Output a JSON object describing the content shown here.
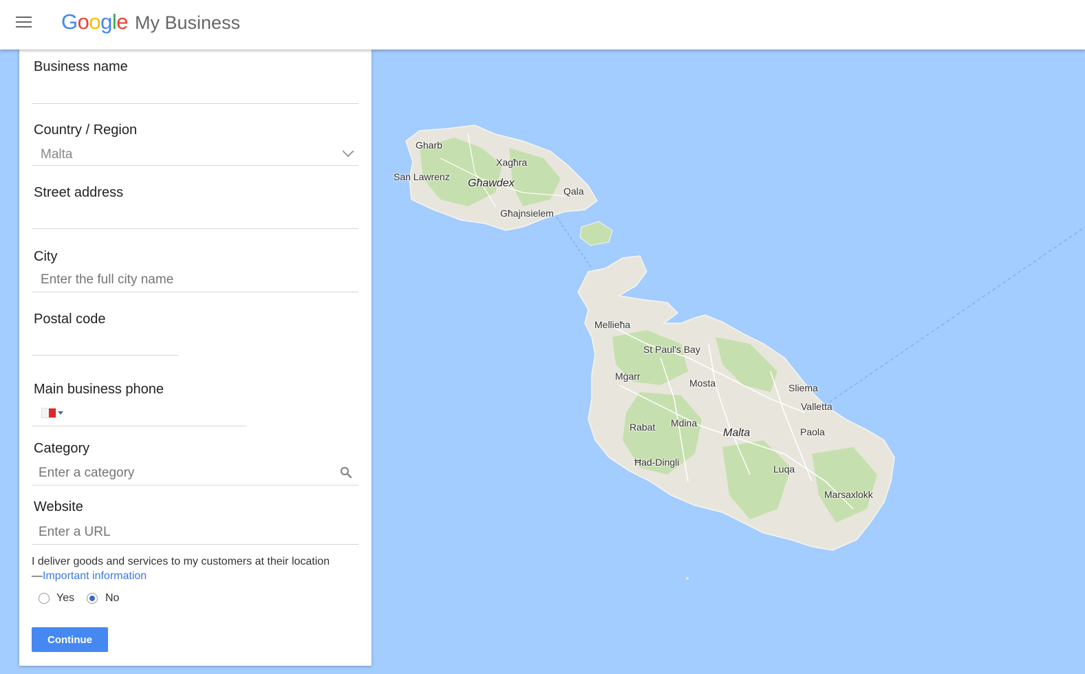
{
  "header": {
    "menu_icon": "hamburger-menu-icon",
    "logo_letters": [
      {
        "ch": "G",
        "color": "#4285f4"
      },
      {
        "ch": "o",
        "color": "#ea4335"
      },
      {
        "ch": "o",
        "color": "#fbbc05"
      },
      {
        "ch": "g",
        "color": "#4285f4"
      },
      {
        "ch": "l",
        "color": "#34a853"
      },
      {
        "ch": "e",
        "color": "#ea4335"
      }
    ],
    "product_name": "My Business"
  },
  "form": {
    "business_name": {
      "label": "Business name",
      "value": ""
    },
    "country": {
      "label": "Country / Region",
      "value": "Malta"
    },
    "street": {
      "label": "Street address",
      "value": ""
    },
    "city": {
      "label": "City",
      "placeholder": "Enter the full city name"
    },
    "postal": {
      "label": "Postal code",
      "value": ""
    },
    "phone": {
      "label": "Main business phone",
      "value": "",
      "flag_icon": "malta-flag-icon"
    },
    "category": {
      "label": "Category",
      "placeholder": "Enter a category",
      "icon": "search-icon"
    },
    "website": {
      "label": "Website",
      "placeholder": "Enter a URL"
    },
    "delivery": {
      "question": "I deliver goods and services to my customers at their location",
      "dash": "—",
      "link": "Important information",
      "options": [
        {
          "label": "Yes",
          "checked": false
        },
        {
          "label": "No",
          "checked": true
        }
      ]
    },
    "continue_label": "Continue",
    "accent_color": "#4688f1"
  },
  "map": {
    "water_color": "#a3ccff",
    "land_color": "#e8e6dc",
    "green_color": "#c6dfae",
    "labels": {
      "gharb": "Gharb",
      "xaghra": "Xagħra",
      "san_lawrenz": "San Lawrenz",
      "ghawdex": "Għawdex",
      "qala": "Qala",
      "ghajnsielem": "Għajnsielem",
      "mellieha": "Mellieħa",
      "st_pauls_bay": "St Paul's Bay",
      "mgarr": "Mġarr",
      "mosta": "Mosta",
      "sliema": "Sliema",
      "valletta": "Valletta",
      "rabat": "Rabat",
      "mdina": "Mdina",
      "malta": "Malta",
      "paola": "Paola",
      "had_dingli": "Ħad-Dingli",
      "luqa": "Luqa",
      "marsaxlokk": "Marsaxlokk"
    }
  }
}
